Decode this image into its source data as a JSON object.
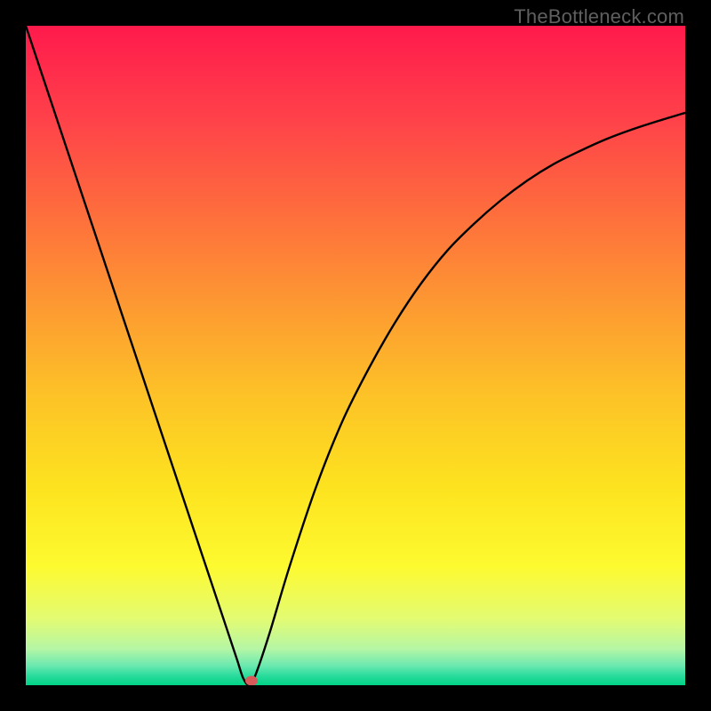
{
  "watermark": "TheBottleneck.com",
  "chart_data": {
    "type": "line",
    "title": "",
    "xlabel": "",
    "ylabel": "",
    "xlim": [
      0,
      100
    ],
    "ylim": [
      0,
      100
    ],
    "background_gradient": {
      "stops": [
        {
          "pos": 0.0,
          "color": "#ff1a4c"
        },
        {
          "pos": 0.14,
          "color": "#ff414a"
        },
        {
          "pos": 0.28,
          "color": "#fe6c3d"
        },
        {
          "pos": 0.42,
          "color": "#fd9832"
        },
        {
          "pos": 0.56,
          "color": "#fdc227"
        },
        {
          "pos": 0.7,
          "color": "#fde31f"
        },
        {
          "pos": 0.82,
          "color": "#fdfa30"
        },
        {
          "pos": 0.9,
          "color": "#e3fb73"
        },
        {
          "pos": 0.945,
          "color": "#b5f6a5"
        },
        {
          "pos": 0.97,
          "color": "#6ce9b0"
        },
        {
          "pos": 0.985,
          "color": "#2cdc9e"
        },
        {
          "pos": 1.0,
          "color": "#00d385"
        }
      ]
    },
    "series": [
      {
        "name": "bottleneck-curve",
        "x": [
          0,
          4,
          8,
          12,
          16,
          20,
          24,
          28,
          30,
          32,
          33,
          34,
          35,
          37,
          40,
          44,
          48,
          52,
          56,
          60,
          64,
          68,
          72,
          76,
          80,
          84,
          88,
          92,
          96,
          100
        ],
        "y": [
          100,
          88,
          76,
          64,
          52,
          40,
          28,
          16,
          10,
          4,
          1,
          0,
          2,
          8,
          18,
          30,
          40,
          48,
          55,
          61,
          66,
          70,
          73.5,
          76.5,
          79,
          81,
          82.8,
          84.3,
          85.6,
          86.8
        ]
      }
    ],
    "marker": {
      "x_frac": 0.342,
      "y_frac": 0.993,
      "color": "#d85a5a"
    }
  }
}
